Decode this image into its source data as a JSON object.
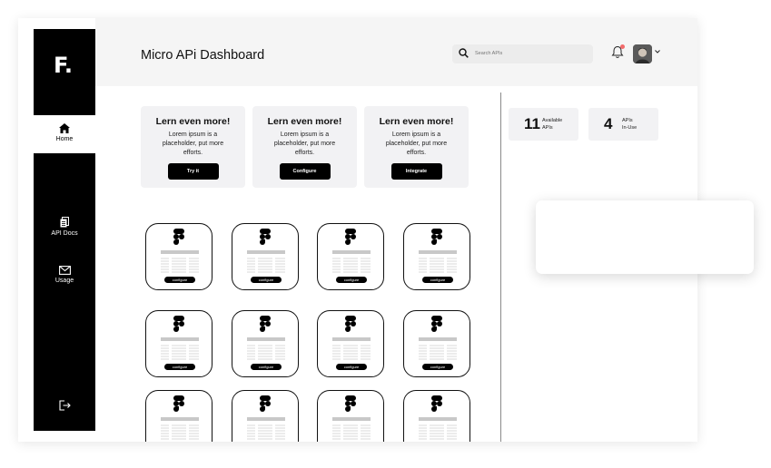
{
  "app": {
    "logo": "F.",
    "title": "Micro APi Dashboard"
  },
  "search": {
    "placeholder": "Search APIs",
    "value": ""
  },
  "sidebar": {
    "items": [
      {
        "label": "Home",
        "icon": "home-icon",
        "active": true
      },
      {
        "label": "API Docs",
        "icon": "docs-icon",
        "active": false
      },
      {
        "label": "Usage",
        "icon": "mail-icon",
        "active": false
      }
    ],
    "logout_icon": "logout-icon"
  },
  "promos": [
    {
      "heading": "Lern even more!",
      "body": "Lorem ipsum is a placeholder, put more efforts.",
      "button": "Try it"
    },
    {
      "heading": "Lern even more!",
      "body": "Lorem ipsum is a placeholder, put more efforts.",
      "button": "Configure"
    },
    {
      "heading": "Lern even more!",
      "body": "Lorem ipsum is a placeholder, put more efforts.",
      "button": "Integrate"
    }
  ],
  "stats": [
    {
      "value": "11",
      "label1": "Available",
      "label2": "APIs"
    },
    {
      "value": "4",
      "label1": "APIs",
      "label2": "In-Use"
    }
  ],
  "cards": [
    {
      "button": "configure"
    },
    {
      "button": "configure"
    },
    {
      "button": "configure"
    },
    {
      "button": "configure"
    },
    {
      "button": "configure"
    },
    {
      "button": "configure"
    },
    {
      "button": "configure"
    },
    {
      "button": "configure"
    },
    {
      "button": ""
    },
    {
      "button": ""
    },
    {
      "button": ""
    },
    {
      "button": ""
    }
  ],
  "colors": {
    "sidebar": "#000000",
    "header": "#f5f5f5",
    "card_surface": "#f2f2f4",
    "notification": "#f26b6b"
  }
}
